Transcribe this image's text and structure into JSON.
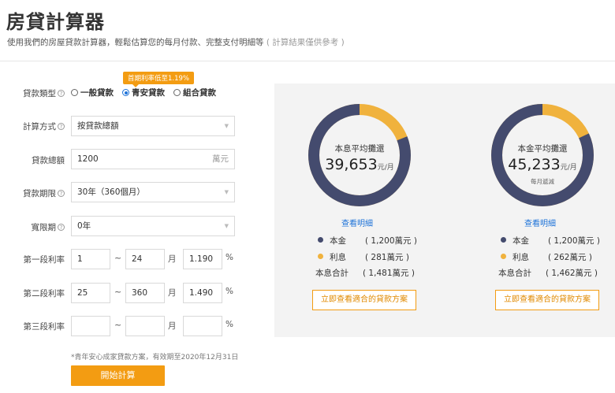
{
  "page": {
    "title": "房貸計算器",
    "subtitle": "使用我們的房屋貸款計算器，輕鬆估算您的每月付款、完整支付明細等",
    "subtitle_note": "( 計算結果僅供參考 )"
  },
  "colors": {
    "accent": "#f39c12",
    "principal": "#444b6e",
    "interest": "#f0b23d",
    "link": "#1e73d8"
  },
  "form": {
    "loan_type": {
      "label": "貸款類型",
      "badge": "首期利率低至1.19%",
      "options": [
        "一般貸款",
        "青安貸款",
        "組合貸款"
      ],
      "selected": "青安貸款"
    },
    "calc_method": {
      "label": "計算方式",
      "value": "按貸款總額"
    },
    "loan_amount": {
      "label": "貸款總額",
      "value": "1200",
      "unit": "萬元"
    },
    "loan_term": {
      "label": "貸款期限",
      "value": "30年（360個月）"
    },
    "grace_period": {
      "label": "寬限期",
      "value": "0年"
    },
    "rate_stage_1": {
      "label": "第一段利率",
      "from": "1",
      "to": "24",
      "month_unit": "月",
      "rate": "1.190",
      "percent": "%"
    },
    "rate_stage_2": {
      "label": "第二段利率",
      "from": "25",
      "to": "360",
      "month_unit": "月",
      "rate": "1.490",
      "percent": "%"
    },
    "rate_stage_3": {
      "label": "第三段利率",
      "from": "",
      "to": "",
      "month_unit": "月",
      "rate": "",
      "percent": "%"
    },
    "range_sep": "~",
    "footnote": "*青年安心成家貸款方案，有效期至2020年12月31日",
    "submit_label": "開始計算"
  },
  "results": [
    {
      "caption": "本息平均攤還",
      "amount": "39,653",
      "amount_unit": "元/月",
      "subcaption": "",
      "principal_share": 0.81,
      "detail_link": "查看明細",
      "principal_label": "本金",
      "principal_value": "( 1,200萬元 )",
      "interest_label": "利息",
      "interest_value": "( 281萬元 )",
      "total_label": "本息合計",
      "total_value": "( 1,481萬元 )",
      "plan_button": "立即查看適合的貸款方案"
    },
    {
      "caption": "本金平均攤還",
      "amount": "45,233",
      "amount_unit": "元/月",
      "subcaption": "每月遞減",
      "principal_share": 0.82,
      "detail_link": "查看明細",
      "principal_label": "本金",
      "principal_value": "( 1,200萬元 )",
      "interest_label": "利息",
      "interest_value": "( 262萬元 )",
      "total_label": "本息合計",
      "total_value": "( 1,462萬元 )",
      "plan_button": "立即查看適合的貸款方案"
    }
  ]
}
